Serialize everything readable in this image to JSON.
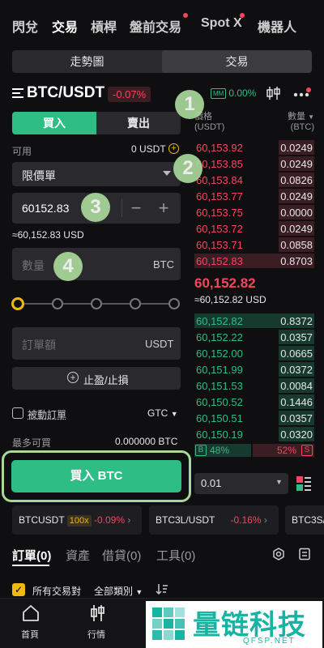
{
  "top_nav": {
    "tabs": [
      "閃兌",
      "交易",
      "槓桿",
      "盤前交易",
      "Spot X",
      "機器人"
    ],
    "active": "交易"
  },
  "view_toggle": {
    "left": "走勢圖",
    "right": "交易",
    "selected": "交易"
  },
  "header": {
    "pair": "BTC/USDT",
    "change": "-0.07%",
    "mm_label": "MM",
    "mm_value": "0.00%"
  },
  "order_form": {
    "buy_label": "買入",
    "sell_label": "賣出",
    "available_label": "可用",
    "available_value": "0 USDT",
    "order_type": "限價單",
    "price_value": "60152.83",
    "price_usd": "≈60,152.83 USD",
    "amount_placeholder": "數量",
    "amount_unit": "BTC",
    "total_placeholder": "訂單額",
    "total_unit": "USDT",
    "tp_sl_label": "止盈/止損",
    "post_only_label": "被動訂單",
    "tif_value": "GTC",
    "max_buy_label": "最多可買",
    "max_buy_value": "0.000000 BTC",
    "submit_label": "買入 BTC",
    "slider_percent": 0
  },
  "orderbook": {
    "col_price": "價格",
    "col_price_unit": "(USDT)",
    "col_qty": "數量",
    "col_qty_unit": "(BTC)",
    "asks": [
      {
        "price": "60,153.92",
        "qty": "0.0249",
        "depth": 0.3
      },
      {
        "price": "60,153.85",
        "qty": "0.0249",
        "depth": 0.3
      },
      {
        "price": "60,153.84",
        "qty": "0.0826",
        "depth": 0.3
      },
      {
        "price": "60,153.77",
        "qty": "0.0249",
        "depth": 0.3
      },
      {
        "price": "60,153.75",
        "qty": "0.0000",
        "depth": 0.3
      },
      {
        "price": "60,153.72",
        "qty": "0.0249",
        "depth": 0.3
      },
      {
        "price": "60,153.71",
        "qty": "0.0858",
        "depth": 0.3
      },
      {
        "price": "60,152.83",
        "qty": "0.8703",
        "depth": 1.0
      }
    ],
    "last_price": "60,152.82",
    "last_price_usd": "≈60,152.82 USD",
    "bids": [
      {
        "price": "60,152.82",
        "qty": "0.8372",
        "depth": 1.0
      },
      {
        "price": "60,152.22",
        "qty": "0.0357",
        "depth": 0.3
      },
      {
        "price": "60,152.00",
        "qty": "0.0665",
        "depth": 0.3
      },
      {
        "price": "60,151.99",
        "qty": "0.0372",
        "depth": 0.3
      },
      {
        "price": "60,151.53",
        "qty": "0.0084",
        "depth": 0.3
      },
      {
        "price": "60,150.52",
        "qty": "0.1446",
        "depth": 0.3
      },
      {
        "price": "60,150.51",
        "qty": "0.0357",
        "depth": 0.3
      },
      {
        "price": "60,150.19",
        "qty": "0.0320",
        "depth": 0.3
      }
    ],
    "buy_ratio_tag": "B",
    "buy_ratio": "48%",
    "sell_ratio": "52%",
    "sell_ratio_tag": "S",
    "precision": "0.01"
  },
  "tickers": [
    {
      "symbol": "BTCUSDT",
      "badge": "100x",
      "change": "-0.09%"
    },
    {
      "symbol": "BTC3L/USDT",
      "change": "-0.16%"
    },
    {
      "symbol": "BTC3S/"
    }
  ],
  "bottom_tabs": {
    "orders": "訂單(0)",
    "assets": "資產",
    "borrow": "借貸(0)",
    "tools": "工具(0)"
  },
  "filter": {
    "all_pairs": "所有交易對",
    "all_categories": "全部類別"
  },
  "bottom_nav": {
    "home": "首頁",
    "markets": "行情"
  },
  "annotations": [
    "1",
    "2",
    "3",
    "4"
  ],
  "watermark": {
    "text": "量链科技",
    "url": "QFSP.NET"
  },
  "colors": {
    "buy": "#2ebd85",
    "sell": "#f6465d",
    "accent": "#f0b90b",
    "annotation": "#a9d89a"
  }
}
